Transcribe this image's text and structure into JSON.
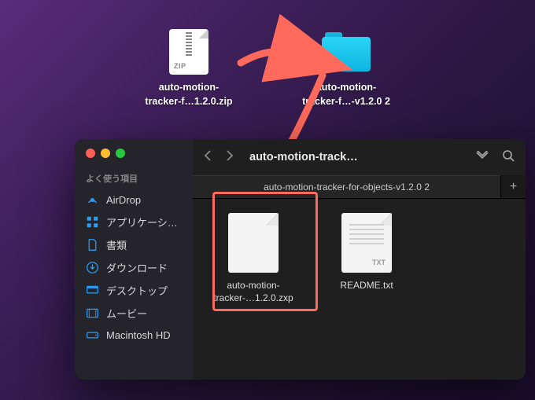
{
  "desktop": {
    "zip": {
      "label_l1": "auto-motion-",
      "label_l2": "tracker-f…1.2.0.zip",
      "ext": "ZIP"
    },
    "folder": {
      "label_l1": "auto-motion-",
      "label_l2": "tracker-f…-v1.2.0 2"
    }
  },
  "finder": {
    "title": "auto-motion-track…",
    "tab": "auto-motion-tracker-for-objects-v1.2.0 2",
    "sidebar": {
      "section": "よく使う項目",
      "items": [
        {
          "label": "AirDrop",
          "icon": "airdrop"
        },
        {
          "label": "アプリケーシ…",
          "icon": "apps"
        },
        {
          "label": "書類",
          "icon": "doc"
        },
        {
          "label": "ダウンロード",
          "icon": "download"
        },
        {
          "label": "デスクトップ",
          "icon": "desktop"
        },
        {
          "label": "ムービー",
          "icon": "movie"
        },
        {
          "label": "Macintosh HD",
          "icon": "hd"
        }
      ]
    },
    "files": [
      {
        "name_l1": "auto-motion-",
        "name_l2": "tracker-…1.2.0.zxp",
        "ext": ""
      },
      {
        "name_l1": "README.txt",
        "name_l2": "",
        "ext": "TXT"
      }
    ]
  },
  "colors": {
    "highlight": "#ff6a5c",
    "arrow": "#ff6a5c",
    "folder": "#2ad4f7",
    "accent": "#2a9df5"
  }
}
